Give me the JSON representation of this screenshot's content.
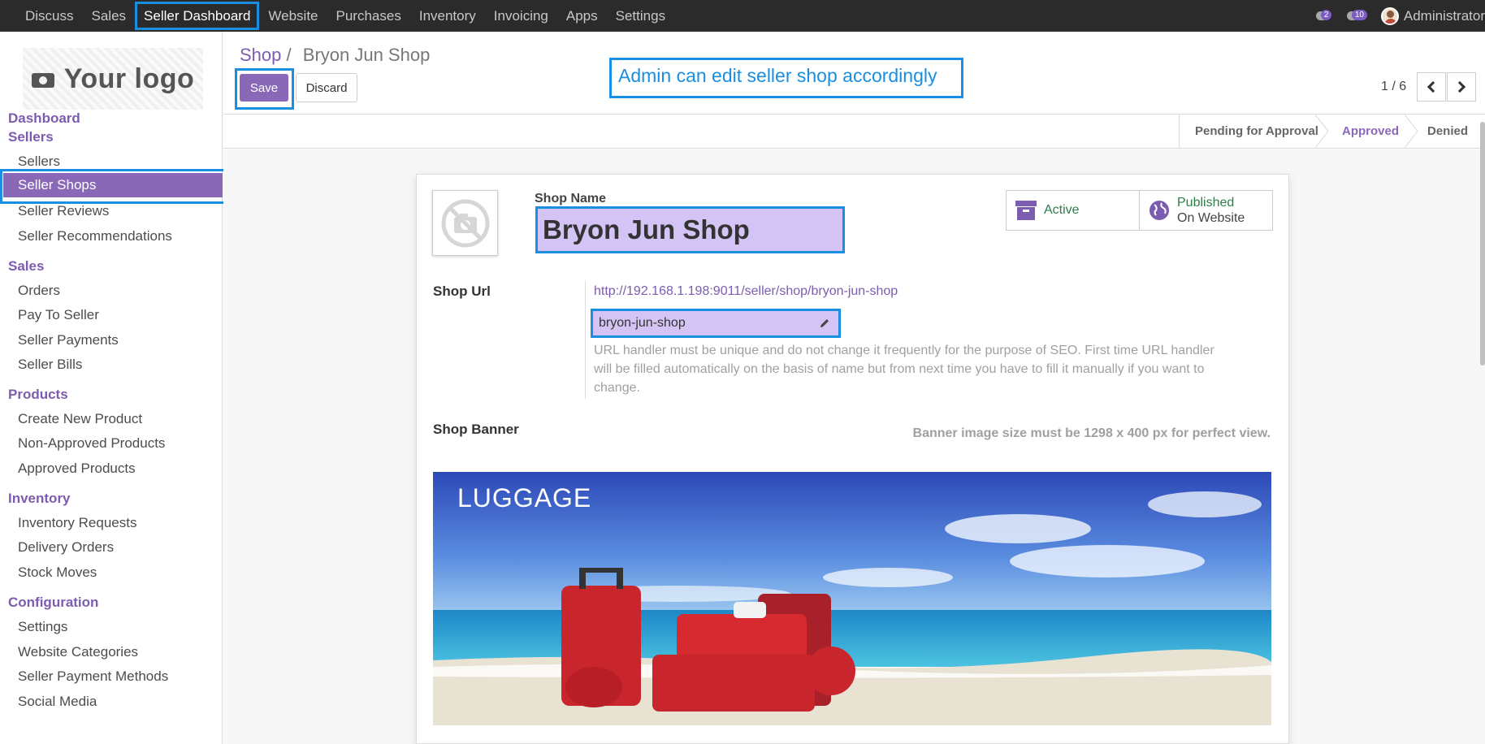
{
  "topbar": {
    "menu": [
      "Discuss",
      "Sales",
      "Seller Dashboard",
      "Website",
      "Purchases",
      "Inventory",
      "Invoicing",
      "Apps",
      "Settings"
    ],
    "active_menu": "Seller Dashboard",
    "activity_badge": "2",
    "message_badge": "10",
    "user_name": "Administrator"
  },
  "sidebar": {
    "logo_text": "Your logo",
    "dashboard": "Dashboard",
    "sections": {
      "sellers": {
        "title": "Sellers",
        "items": [
          "Sellers",
          "Seller Shops",
          "Seller Reviews",
          "Seller Recommendations"
        ]
      },
      "sales": {
        "title": "Sales",
        "items": [
          "Orders",
          "Pay To Seller",
          "Seller Payments",
          "Seller Bills"
        ]
      },
      "products": {
        "title": "Products",
        "items": [
          "Create New Product",
          "Non-Approved Products",
          "Approved Products"
        ]
      },
      "inventory": {
        "title": "Inventory",
        "items": [
          "Inventory Requests",
          "Delivery Orders",
          "Stock Moves"
        ]
      },
      "configuration": {
        "title": "Configuration",
        "items": [
          "Settings",
          "Website Categories",
          "Seller Payment Methods",
          "Social Media"
        ]
      }
    },
    "active_item": "Seller Shops"
  },
  "control_panel": {
    "breadcrumb_parent": "Shop",
    "breadcrumb_sep": "/",
    "breadcrumb_current": "Bryon Jun Shop",
    "save_label": "Save",
    "discard_label": "Discard",
    "pager": "1 / 6"
  },
  "annotation": "Admin can edit seller shop accordingly",
  "statusbar": {
    "stages": [
      "Pending for Approval",
      "Approved",
      "Denied"
    ],
    "current_stage": "Approved"
  },
  "form": {
    "shop_name_label": "Shop Name",
    "shop_name_value": "Bryon Jun Shop",
    "active_label": "Active",
    "published_label": "Published",
    "published_sub": "On Website",
    "shop_url_label": "Shop Url",
    "shop_url_value": "http://192.168.1.198:9011/seller/shop/bryon-jun-shop",
    "url_handler_value": "bryon-jun-shop",
    "url_help": "URL handler must be unique and do not change it frequently for the purpose of SEO. First time URL handler will be filled automatically on the basis of name but from next time you have to fill it manually if you want to change.",
    "shop_banner_label": "Shop Banner",
    "banner_note": "Banner image size must be 1298 x 400 px for perfect view.",
    "banner_caption": "LUGGAGE"
  },
  "colors": {
    "brand": "#8a68b8",
    "link": "#7c5cb0",
    "highlight": "#1a8fe0",
    "edit_field": "#d4c4f6",
    "status_active": "#2e7d4a"
  }
}
